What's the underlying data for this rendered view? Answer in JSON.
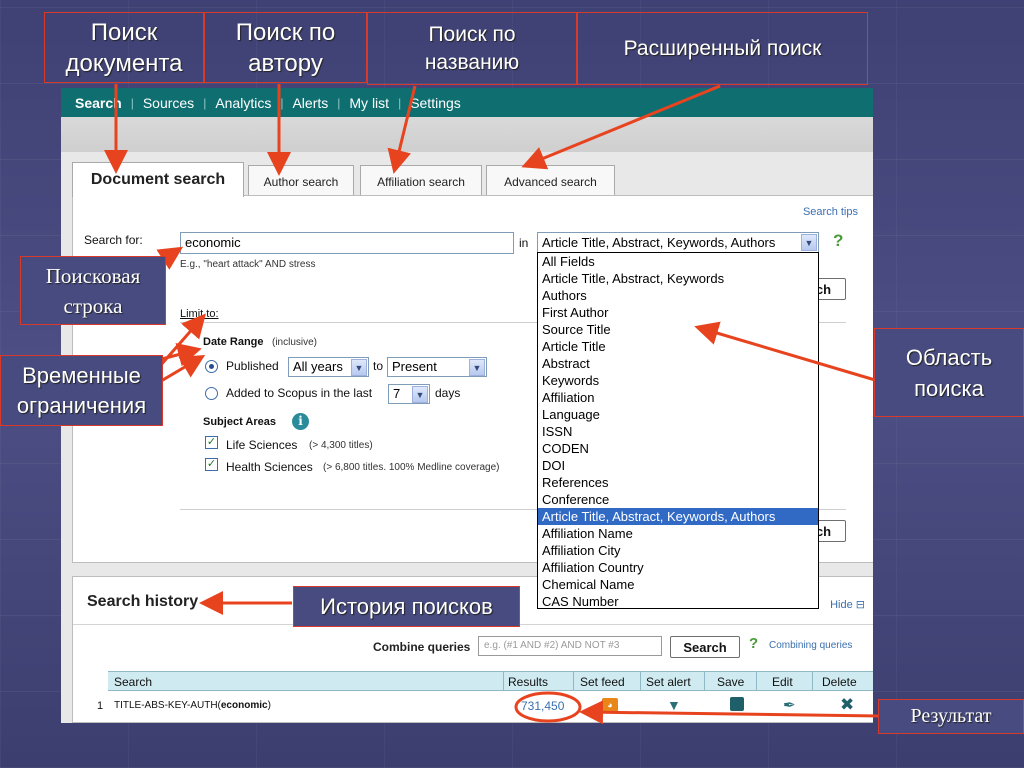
{
  "annotations": {
    "doc_search": "Поиск документа",
    "author_search": "Поиск по автору",
    "title_search": "Поиск по названию",
    "advanced_search": "Расширенный поиск",
    "search_string": "Поисковая строка",
    "time_limits": "Временные ограничения",
    "search_area": "Область поиска",
    "history": "История поисков",
    "result": "Результат"
  },
  "nav": {
    "items": [
      "Search",
      "Sources",
      "Analytics",
      "Alerts",
      "My list",
      "Settings"
    ]
  },
  "tabs": [
    "Document search",
    "Author search",
    "Affiliation search",
    "Advanced search"
  ],
  "search": {
    "tips": "Search tips",
    "label": "Search for:",
    "value": "economic",
    "example": "E.g., \"heart attack\" AND stress",
    "in_label": "in",
    "field_selected": "Article Title, Abstract, Keywords, Authors",
    "help": "?",
    "button": "Search",
    "button_visible": "ch"
  },
  "field_options": [
    "All Fields",
    "Article Title, Abstract, Keywords",
    "Authors",
    "First Author",
    "Source Title",
    "Article Title",
    "Abstract",
    "Keywords",
    "Affiliation",
    "Language",
    "ISSN",
    "CODEN",
    "DOI",
    "References",
    "Conference",
    "Article Title, Abstract, Keywords, Authors",
    "Affiliation Name",
    "Affiliation City",
    "Affiliation Country",
    "Chemical Name",
    "CAS Number"
  ],
  "selected_option_index": 15,
  "limits": {
    "title": "Limit to:",
    "date_range": "Date Range",
    "inclusive": "(inclusive)",
    "published": "Published",
    "years_from": "All years",
    "to": "to",
    "years_to": "Present",
    "added": "Added to Scopus in the last",
    "days_value": "7",
    "days": "days",
    "subject_areas": "Subject Areas",
    "life_sciences": "Life Sciences",
    "life_count": "(> 4,300 titles)",
    "health_sciences": "Health Sciences",
    "health_count": "(> 6,800 titles. 100% Medline coverage)"
  },
  "history": {
    "title": "Search history",
    "hide": "Hide",
    "combine_label": "Combine queries",
    "combine_placeholder": "e.g. (#1 AND #2) AND NOT #3",
    "search_button": "Search",
    "combine_link": "Combining queries",
    "columns": [
      "Search",
      "Results",
      "Set feed",
      "Set alert",
      "Save",
      "Edit",
      "Delete"
    ],
    "rows": [
      {
        "num": "1",
        "query_prefix": "TITLE-ABS-KEY-AUTH(",
        "query_term": "economic",
        "query_suffix": ")",
        "results": "731,450"
      }
    ]
  },
  "colors": {
    "nav_bg": "#0f6e70",
    "annotation_border": "#d73a2a",
    "arrow": "#e8431f",
    "link": "#3a6fb0",
    "dropdown_selected": "#316ac5"
  }
}
